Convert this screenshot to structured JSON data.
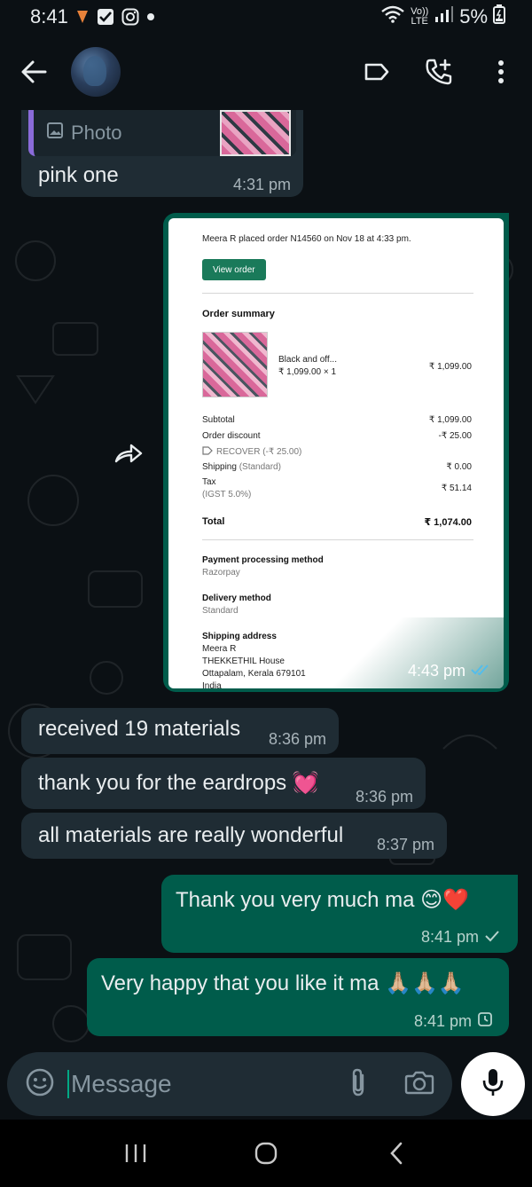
{
  "status_bar": {
    "time": "8:41",
    "network_label": "Vo)) LTE",
    "battery": "5%"
  },
  "contact": {
    "avatar_icon": "contact-avatar"
  },
  "messages": [
    {
      "type": "incoming",
      "quote_label": "Photo",
      "text": "pink one",
      "time": "4:31 pm"
    },
    {
      "type": "outgoing-image",
      "time": "4:43 pm",
      "order": {
        "headline": "Meera R placed order N14560 on Nov 18 at 4:33 pm.",
        "view_button": "View order",
        "summary_title": "Order summary",
        "item_name": "Black and off...",
        "item_qty": "₹ 1,099.00 × 1",
        "item_total": "₹ 1,099.00",
        "subtotal_label": "Subtotal",
        "subtotal_value": "₹ 1,099.00",
        "discount_label": "Order discount",
        "discount_value": "-₹ 25.00",
        "discount_code": "RECOVER (-₹ 25.00)",
        "shipping_label": "Shipping",
        "shipping_note": "(Standard)",
        "shipping_value": "₹ 0.00",
        "tax_label": "Tax",
        "tax_note": "(IGST 5.0%)",
        "tax_value": "₹ 51.14",
        "total_label": "Total",
        "total_value": "₹ 1,074.00",
        "payment_title": "Payment processing method",
        "payment_value": "Razorpay",
        "delivery_title": "Delivery method",
        "delivery_value": "Standard",
        "address_title": "Shipping address",
        "address_line1": "Meera R",
        "address_line2": "THEKKETHIL House",
        "address_line3": "Ottapalam, Kerala 679101",
        "address_line4": "India"
      }
    },
    {
      "type": "incoming",
      "text": "received 19 materials",
      "time": "8:36 pm"
    },
    {
      "type": "incoming",
      "text": "thank you for the eardrops 💓",
      "time": "8:36 pm"
    },
    {
      "type": "incoming",
      "text": "all materials are really wonderful",
      "time": "8:37 pm"
    },
    {
      "type": "outgoing",
      "text": "Thank you very much ma 😊❤️",
      "time": "8:41 pm"
    },
    {
      "type": "outgoing",
      "text": "Very happy that you like it ma 🙏🏼🙏🏼🙏🏼",
      "time": "8:41 pm"
    }
  ],
  "composer": {
    "placeholder": "Message"
  },
  "colors": {
    "background": "#0b1014",
    "incoming_bubble": "#1f2c34",
    "outgoing_bubble": "#005c4b",
    "accent": "#00a884"
  }
}
